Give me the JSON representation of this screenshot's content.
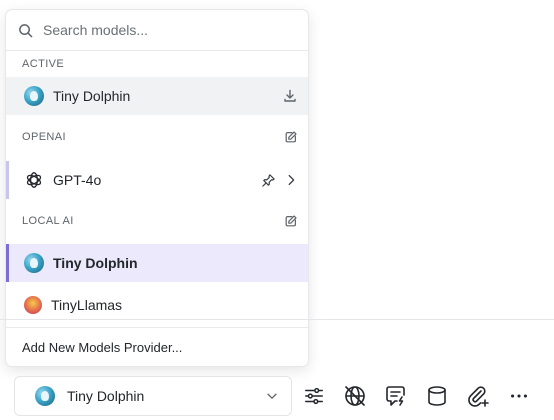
{
  "search": {
    "placeholder": "Search models..."
  },
  "sections": {
    "active": {
      "title": "ACTIVE",
      "model_label": "Tiny Dolphin",
      "model_icon": "dolphin-avatar-icon",
      "action_icon": "download-icon"
    },
    "openai": {
      "title": "OPENAI",
      "edit_icon": "edit-icon",
      "model_label": "GPT-4o",
      "model_icon": "openai-logo-icon",
      "pin_icon": "pin-icon",
      "expand_icon": "chevron-right-icon",
      "accent_color": "#c9c6ee"
    },
    "local_ai": {
      "title": "LOCAL AI",
      "edit_icon": "edit-icon",
      "models": [
        {
          "label": "Tiny Dolphin",
          "icon": "dolphin-avatar-icon",
          "selected": true
        },
        {
          "label": "TinyLlamas",
          "icon": "llama-avatar-icon",
          "selected": false
        }
      ],
      "accent_color": "#7b6fd6"
    }
  },
  "footer": {
    "add_provider_label": "Add New Models Provider..."
  },
  "composer": {
    "model_selector_label": "Tiny Dolphin",
    "model_selector_icon": "dolphin-avatar-icon",
    "toolbar_icons": [
      "sliders-icon",
      "globe-off-icon",
      "message-bolt-icon",
      "cylinder-icon",
      "attach-plus-icon",
      "more-icon"
    ]
  },
  "colors": {
    "selected_row_bg": "#ebe9fb",
    "hover_row_bg": "#f1f2f4",
    "selected_accent": "#7b6fd6"
  }
}
